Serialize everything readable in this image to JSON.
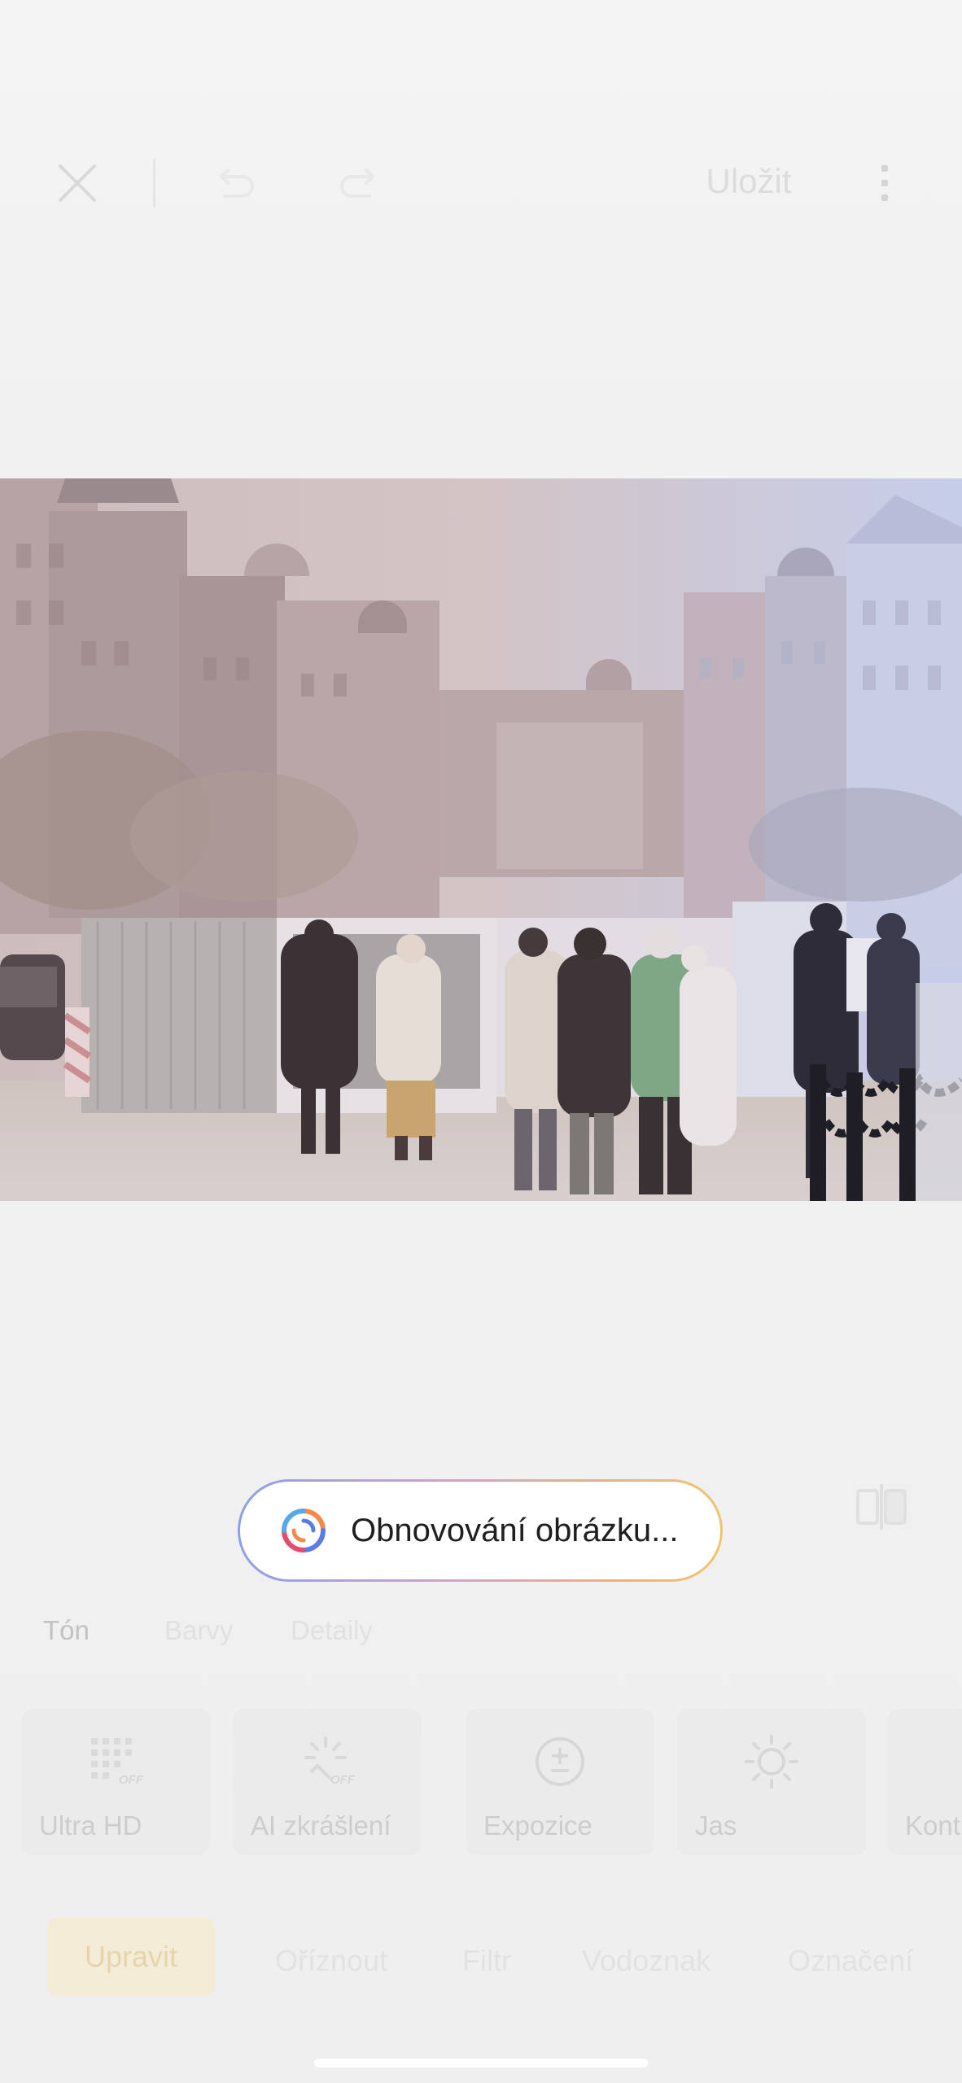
{
  "toolbar": {
    "save_label": "Uložit",
    "icons": [
      "close-icon",
      "undo-icon",
      "redo-icon",
      "more-icon"
    ]
  },
  "status": {
    "restoring_text": "Obnovování obrázku..."
  },
  "adjust_tabs": [
    {
      "label": "Tón",
      "active": true
    },
    {
      "label": "Barvy",
      "active": false
    },
    {
      "label": "Detaily",
      "active": false
    }
  ],
  "tools": [
    {
      "label": "Ultra HD",
      "icon": "ultra-hd-off-icon"
    },
    {
      "label": "AI zkrášlení",
      "icon": "ai-beautify-off-icon"
    },
    {
      "label": "Expozice",
      "icon": "exposure-icon"
    },
    {
      "label": "Jas",
      "icon": "brightness-icon"
    },
    {
      "label": "Kontrast",
      "icon": "contrast-icon"
    }
  ],
  "modes": [
    {
      "label": "Upravit",
      "active": true
    },
    {
      "label": "Oříznout",
      "active": false
    },
    {
      "label": "Filtr",
      "active": false
    },
    {
      "label": "Vodoznak",
      "active": false
    },
    {
      "label": "Označení",
      "active": false
    }
  ],
  "colors": {
    "accent_active_tab": "#f5ecd8",
    "pill_gradient": [
      "#8fa0e8",
      "#d3a3c9",
      "#e9b08a",
      "#f1c46e"
    ]
  }
}
